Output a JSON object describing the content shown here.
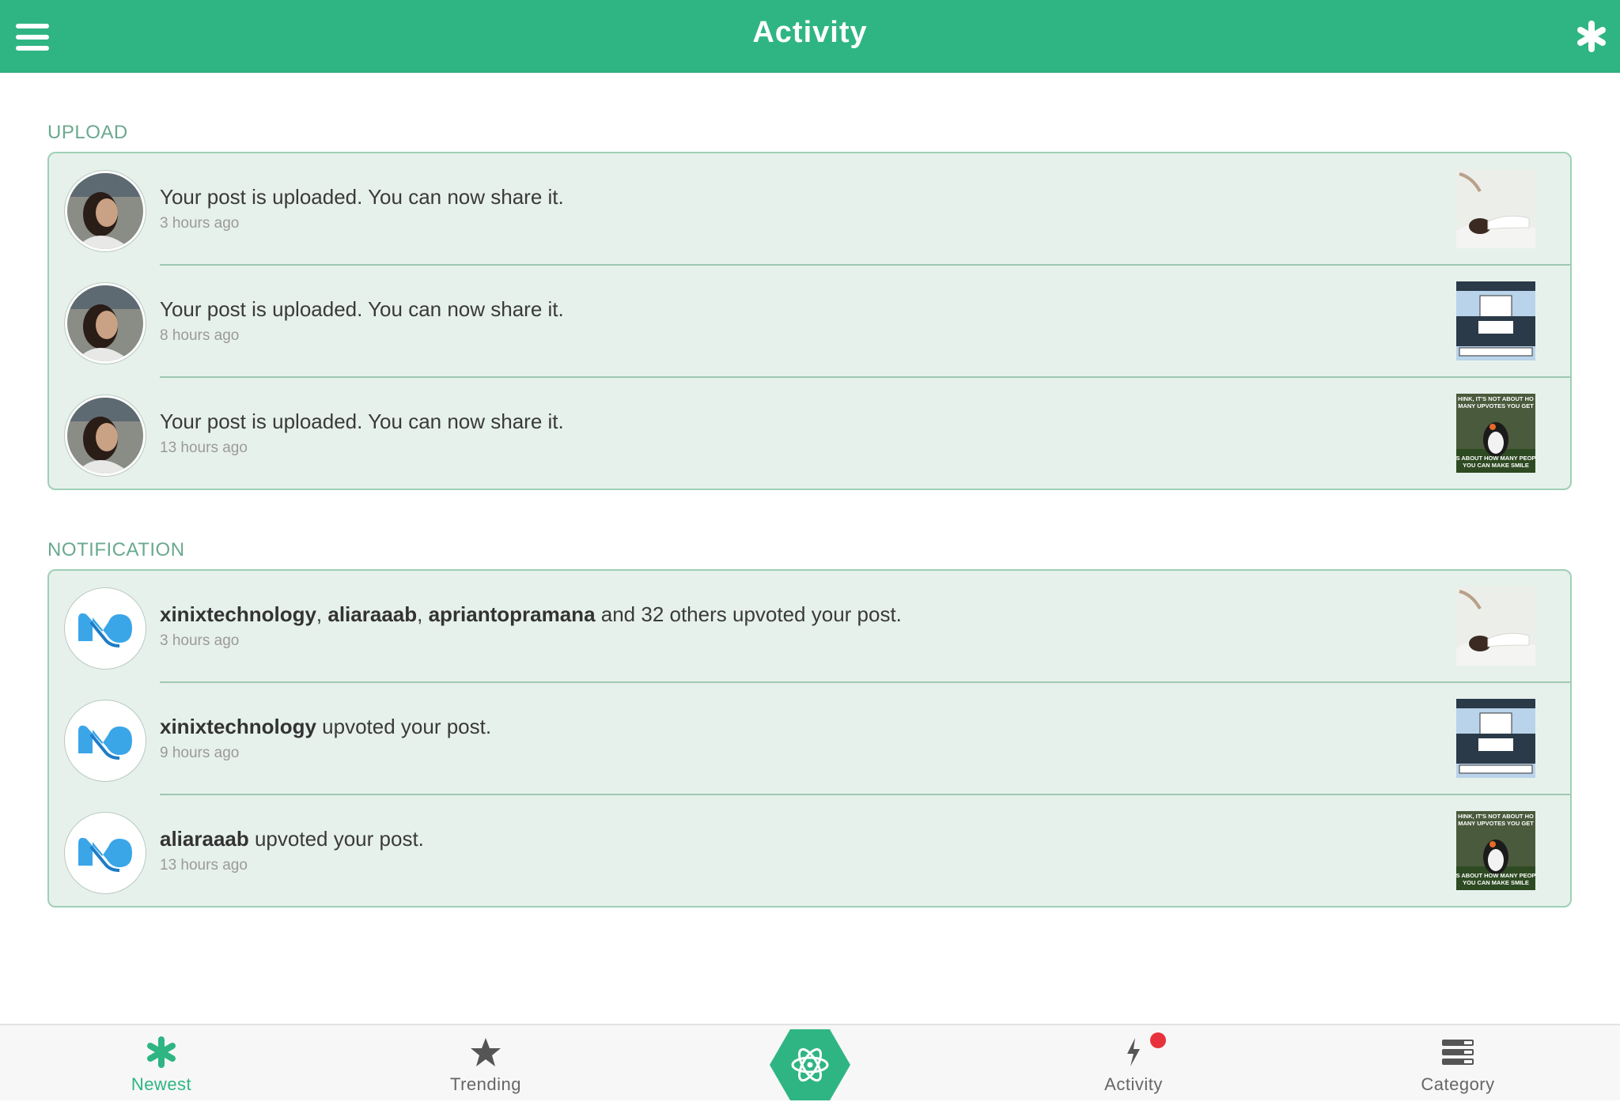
{
  "header": {
    "title": "Activity"
  },
  "sections": {
    "upload": {
      "label": "UPLOAD",
      "items": [
        {
          "message": "Your post is uploaded. You can now share it.",
          "time": "3 hours ago"
        },
        {
          "message": "Your post is uploaded. You can now share it.",
          "time": "8 hours ago"
        },
        {
          "message": "Your post is uploaded. You can now share it.",
          "time": "13 hours ago"
        }
      ]
    },
    "notification": {
      "label": "NOTIFICATION",
      "items": [
        {
          "users": [
            "xinixtechnology",
            "aliaraaab",
            "apriantopramana"
          ],
          "sep1": ", ",
          "sep2": ", ",
          "rest": " and 32 others upvoted your post.",
          "time": "3 hours ago"
        },
        {
          "users": [
            "xinixtechnology"
          ],
          "rest": " upvoted your post.",
          "time": "9 hours ago"
        },
        {
          "users": [
            "aliaraaab"
          ],
          "rest": " upvoted your post.",
          "time": "13 hours ago"
        }
      ]
    }
  },
  "thumbnails": {
    "meme_text_top": "THINK, IT'S NOT ABOUT HOW MANY UPVOTES YOU GET",
    "meme_text_bottom": "IT'S ABOUT HOW MANY PEOPLE YOU CAN MAKE SMILE"
  },
  "tabbar": {
    "tabs": [
      {
        "label": "Newest",
        "icon": "asterisk-icon"
      },
      {
        "label": "Trending",
        "icon": "star-icon"
      },
      {
        "label": "Activity",
        "icon": "bolt-icon"
      },
      {
        "label": "Category",
        "icon": "stack-icon"
      }
    ],
    "center_icon": "atom-icon"
  },
  "colors": {
    "brand": "#2fb583",
    "card_bg": "#e7f1ec",
    "badge": "#e8323b"
  }
}
